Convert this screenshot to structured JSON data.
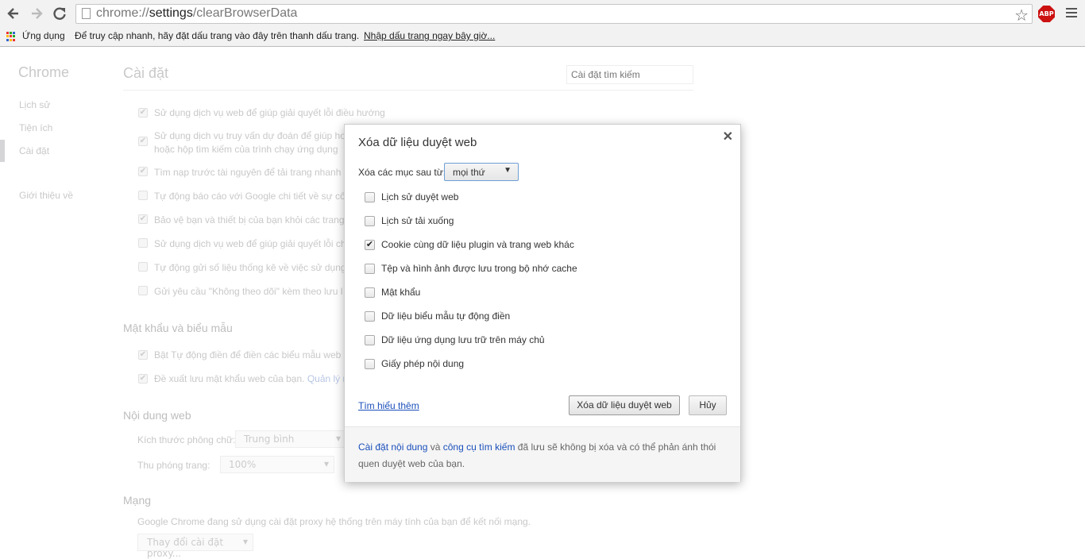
{
  "browser": {
    "url_prefix": "chrome://",
    "url_host": "settings",
    "url_path": "/clearBrowserData",
    "extension_badge": "ABP",
    "bookmarks": {
      "apps_label": "Ứng dụng",
      "hint": "Để truy cập nhanh, hãy đặt dấu trang vào đây trên thanh dấu trang.",
      "import_link": "Nhập dấu trang ngay bây giờ..."
    }
  },
  "sidebar": {
    "title": "Chrome",
    "items": [
      {
        "label": "Lịch sử"
      },
      {
        "label": "Tiện ích"
      },
      {
        "label": "Cài đặt",
        "active": true
      },
      {
        "label": "Giới thiệu về"
      }
    ]
  },
  "settings": {
    "title": "Cài đặt",
    "search_placeholder": "Cài đặt tìm kiếm",
    "privacy_rows": [
      {
        "label": "Sử dụng dịch vụ web để giúp giải quyết lỗi điều hướng",
        "checked": true
      },
      {
        "label": "Sử dụng dịch vụ truy vấn dự đoán để giúp ho",
        "label2": "hoặc hộp tìm kiếm của trình chạy ứng dụng",
        "checked": true
      },
      {
        "label": "Tìm nạp trước tài nguyên để tải trang nhanh",
        "checked": true
      },
      {
        "label": "Tự động báo cáo với Google chi tiết về sự cố",
        "checked": false
      },
      {
        "label": "Bảo vệ bạn và thiết bị của bạn khỏi các trang",
        "checked": true
      },
      {
        "label": "Sử dụng dịch vụ web để giúp giải quyết lỗi ch",
        "checked": false
      },
      {
        "label": "Tự động gửi số liệu thống kê về việc sử dụng",
        "checked": false
      },
      {
        "label": "Gửi yêu cầu \"Không theo dõi\" kèm theo lưu l",
        "checked": false
      }
    ],
    "passwords_heading": "Mật khẩu và biểu mẫu",
    "password_rows": [
      {
        "label": "Bật Tự động điền để điền các biểu mẫu web b",
        "checked": true
      },
      {
        "label": "Đề xuất lưu mật khẩu web của bạn.",
        "link": "Quản lý m",
        "checked": true
      }
    ],
    "web_content_heading": "Nội dung web",
    "font_size_label": "Kích thước phông chữ:",
    "font_size_value": "Trung bình",
    "zoom_label": "Thu phóng trang:",
    "zoom_value": "100%",
    "network_heading": "Mạng",
    "network_text": "Google Chrome đang sử dụng cài đặt proxy hệ thống trên máy tính của bạn để kết nối mạng.",
    "proxy_button": "Thay đổi cài đặt proxy..."
  },
  "dialog": {
    "title": "Xóa dữ liệu duyệt web",
    "range_label": "Xóa các mục sau từ:",
    "range_value": "mọi thứ",
    "options": [
      {
        "label": "Lịch sử duyệt web",
        "checked": false
      },
      {
        "label": "Lịch sử tải xuống",
        "checked": false
      },
      {
        "label": "Cookie cùng dữ liệu plugin và trang web khác",
        "checked": true
      },
      {
        "label": "Tệp và hình ảnh được lưu trong bộ nhớ cache",
        "checked": false
      },
      {
        "label": "Mật khẩu",
        "checked": false
      },
      {
        "label": "Dữ liệu biểu mẫu tự động điền",
        "checked": false
      },
      {
        "label": "Dữ liệu ứng dụng lưu trữ trên máy chủ",
        "checked": false
      },
      {
        "label": "Giấy phép nội dung",
        "checked": false
      }
    ],
    "learn_more": "Tìm hiểu thêm",
    "clear_button": "Xóa dữ liệu duyệt web",
    "cancel_button": "Hủy",
    "footer_link1": "Cài đặt nội dung",
    "footer_and": " và ",
    "footer_link2": "công cụ tìm kiếm",
    "footer_text": " đã lưu sẽ không bị xóa và có thể phản ánh thói quen duyệt web của bạn."
  }
}
